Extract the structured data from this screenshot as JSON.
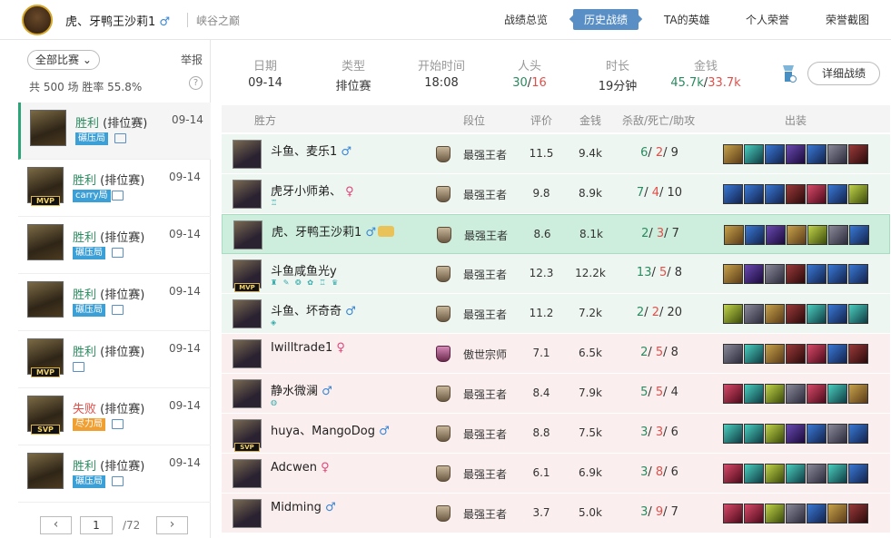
{
  "header": {
    "player_name": "虎、牙鸭王沙莉1",
    "gender": "♂",
    "server": "峡谷之巅",
    "nav": [
      "战绩总览",
      "历史战绩",
      "TA的英雄",
      "个人荣誉",
      "荣誉截图"
    ],
    "active_nav": 1
  },
  "left": {
    "filter": "全部比赛",
    "filter_arrow": "⌄",
    "report": "举报",
    "summary": "共 500 场  胜率 55.8%",
    "help": "?",
    "matches": [
      {
        "result": "胜利",
        "type": "(排位赛)",
        "date": "09-14",
        "tag": "碾压局",
        "mvp": ""
      },
      {
        "result": "胜利",
        "type": "(排位赛)",
        "date": "09-14",
        "tag": "carry局",
        "mvp": "MVP"
      },
      {
        "result": "胜利",
        "type": "(排位赛)",
        "date": "09-14",
        "tag": "碾压局",
        "mvp": ""
      },
      {
        "result": "胜利",
        "type": "(排位赛)",
        "date": "09-14",
        "tag": "碾压局",
        "mvp": ""
      },
      {
        "result": "胜利",
        "type": "(排位赛)",
        "date": "09-14",
        "tag": "",
        "mvp": "MVP"
      },
      {
        "result": "失败",
        "type": "(排位赛)",
        "date": "09-14",
        "tag": "尽力局",
        "mvp": "SVP"
      },
      {
        "result": "胜利",
        "type": "(排位赛)",
        "date": "09-14",
        "tag": "碾压局",
        "mvp": ""
      }
    ],
    "pager": {
      "prev": "‹",
      "current": "1",
      "total": "/72",
      "next": "›"
    }
  },
  "summary": {
    "labels": [
      "日期",
      "类型",
      "开始时间",
      "人头",
      "时长",
      "金钱"
    ],
    "date": "09-14",
    "type": "排位赛",
    "start": "18:08",
    "kills_a": "30",
    "kills_b": "16",
    "duration": "19分钟",
    "gold_a": "45.7k",
    "gold_b": "33.7k",
    "detail_btn": "详细战绩"
  },
  "table": {
    "headers": [
      "胜方",
      "段位",
      "评价",
      "金钱",
      "杀敌/死亡/助攻",
      "出装"
    ],
    "rows": [
      {
        "name": "斗鱼、麦乐1",
        "g": "♂",
        "badges": "",
        "rank": "最强王者",
        "score": "11.5",
        "gold": "9.4k",
        "k": "6",
        "d": "2",
        "a": "9",
        "mvp": ""
      },
      {
        "name": "虎牙小师弟、",
        "g": "♀",
        "badges": "♖",
        "rank": "最强王者",
        "score": "9.8",
        "gold": "8.9k",
        "k": "7",
        "d": "4",
        "a": "10",
        "mvp": ""
      },
      {
        "name": "虎、牙鸭王沙莉1",
        "g": "♂",
        "badges": "",
        "rank": "最强王者",
        "score": "8.6",
        "gold": "8.1k",
        "k": "2",
        "d": "3",
        "a": "7",
        "mvp": ""
      },
      {
        "name": "斗鱼咸鱼光y",
        "g": "",
        "badges": "♜ ✎ ❂ ✿ ♖ ♛",
        "rank": "最强王者",
        "score": "12.3",
        "gold": "12.2k",
        "k": "13",
        "d": "5",
        "a": "8",
        "mvp": "MVP"
      },
      {
        "name": "斗鱼、坏奇奇",
        "g": "♂",
        "badges": "◈",
        "rank": "最强王者",
        "score": "11.2",
        "gold": "7.2k",
        "k": "2",
        "d": "2",
        "a": "20",
        "mvp": ""
      },
      {
        "name": "Iwilltrade1",
        "g": "♀",
        "badges": "",
        "rank": "傲世宗师",
        "score": "7.1",
        "gold": "6.5k",
        "k": "2",
        "d": "5",
        "a": "8",
        "mvp": ""
      },
      {
        "name": "静水微澜",
        "g": "♂",
        "badges": "◍",
        "rank": "最强王者",
        "score": "8.4",
        "gold": "7.9k",
        "k": "5",
        "d": "5",
        "a": "4",
        "mvp": ""
      },
      {
        "name": "huya、MangoDog",
        "g": "♂",
        "badges": "",
        "rank": "最强王者",
        "score": "8.8",
        "gold": "7.5k",
        "k": "3",
        "d": "3",
        "a": "6",
        "mvp": "SVP"
      },
      {
        "name": "Adcwen",
        "g": "♀",
        "badges": "",
        "rank": "最强王者",
        "score": "6.1",
        "gold": "6.9k",
        "k": "3",
        "d": "8",
        "a": "6",
        "mvp": ""
      },
      {
        "name": "Midming",
        "g": "♂",
        "badges": "",
        "rank": "最强王者",
        "score": "3.7",
        "gold": "5.0k",
        "k": "3",
        "d": "9",
        "a": "7",
        "mvp": ""
      }
    ]
  }
}
